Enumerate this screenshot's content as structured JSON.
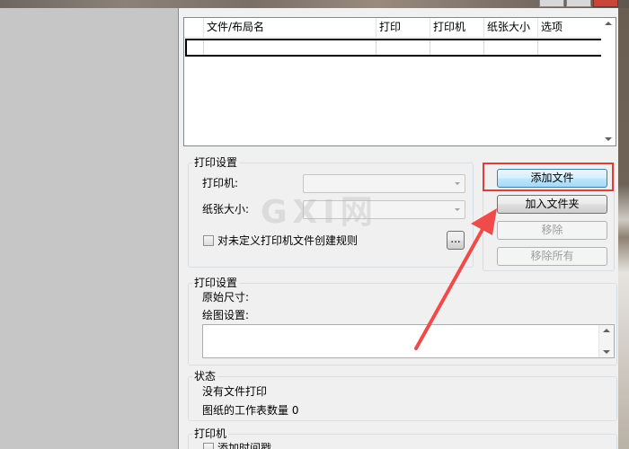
{
  "file_list": {
    "columns": [
      "",
      "文件/布局名",
      "打印",
      "打印机",
      "纸张大小",
      "选项"
    ],
    "rows": [
      [
        "",
        "",
        "",
        "",
        "",
        ""
      ]
    ]
  },
  "print_settings_group": {
    "title": "打印设置",
    "printer_label": "打印机:",
    "printer_value": "",
    "paper_size_label": "纸张大小:",
    "paper_size_value": "",
    "rule_checkbox_label": "对未定义打印机文件创建规则",
    "rule_checked": false,
    "browse_label": "..."
  },
  "buttons": {
    "add_file": "添加文件",
    "add_folder": "加入文件夹",
    "remove": "移除",
    "remove_all": "移除所有"
  },
  "print_settings_group2": {
    "title": "打印设置",
    "original_size_label": "原始尺寸:",
    "plot_settings_label": "绘图设置:",
    "plot_settings_value": ""
  },
  "status_group": {
    "title": "状态",
    "status_text": "没有文件打印",
    "sheet_count_text": "图纸的工作表数量 0"
  },
  "printer_group": {
    "title": "打印机",
    "timestamp_label": "添加时间戳"
  },
  "watermark": "GXI网",
  "colors": {
    "highlight": "#e23b3b",
    "arrow": "#ef4b4b",
    "primary_button": "#bee6fd"
  }
}
